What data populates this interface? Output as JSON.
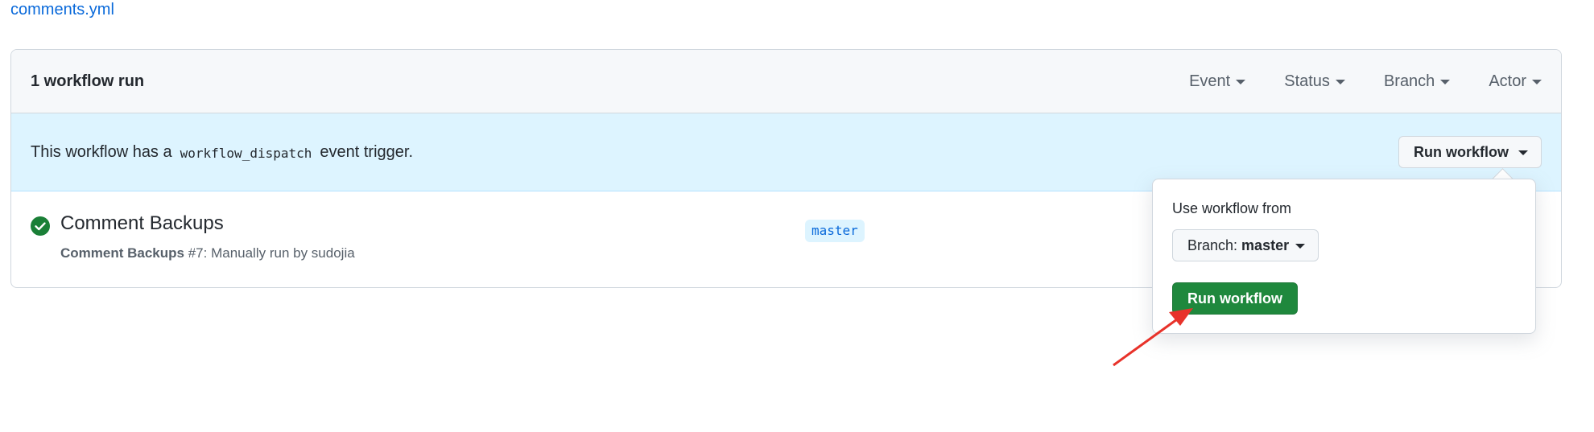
{
  "file_link": "comments.yml",
  "header": {
    "run_count": "1 workflow run",
    "filters": [
      "Event",
      "Status",
      "Branch",
      "Actor"
    ]
  },
  "notice": {
    "prefix": "This workflow has a",
    "code": "workflow_dispatch",
    "suffix": "event trigger.",
    "button_label": "Run workflow"
  },
  "run": {
    "title": "Comment Backups",
    "meta_name": "Comment Backups",
    "meta_detail": "#7: Manually run by sudojia",
    "branch": "master",
    "status_icon": "check-circle-icon",
    "status_color": "#1a7f37"
  },
  "popover": {
    "label": "Use workflow from",
    "branch_prefix": "Branch:",
    "branch_value": "master",
    "run_button": "Run workflow"
  },
  "annotation": {
    "color": "#e8322a",
    "icon": "red-arrow"
  }
}
